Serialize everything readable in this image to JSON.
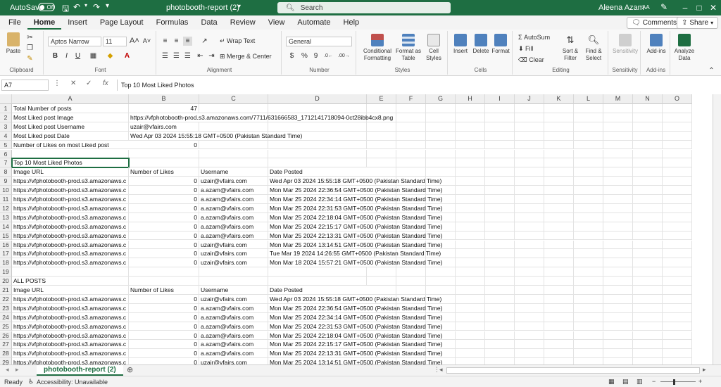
{
  "titlebar": {
    "autosave_label": "AutoSave",
    "autosave_state": "Off",
    "doc_title": "photobooth-report (2)",
    "search_placeholder": "Search",
    "user_name": "Aleena Azam",
    "user_initials": "AA"
  },
  "menu": {
    "tabs": [
      "File",
      "Home",
      "Insert",
      "Page Layout",
      "Formulas",
      "Data",
      "Review",
      "View",
      "Automate",
      "Help"
    ],
    "active": "Home",
    "comments_label": "Comments",
    "share_label": "Share"
  },
  "ribbon": {
    "clipboard": {
      "paste_label": "Paste",
      "group_label": "Clipboard"
    },
    "font": {
      "font_name": "Aptos Narrow",
      "font_size": "11",
      "group_label": "Font",
      "bold": "B",
      "italic": "I",
      "underline": "U"
    },
    "alignment": {
      "wrap_label": "Wrap Text",
      "merge_label": "Merge & Center",
      "group_label": "Alignment"
    },
    "number": {
      "format": "General",
      "group_label": "Number"
    },
    "styles": {
      "conditional_label": "Conditional Formatting",
      "format_table_label": "Format as Table",
      "cell_styles_label": "Cell Styles",
      "group_label": "Styles"
    },
    "cells": {
      "insert_label": "Insert",
      "delete_label": "Delete",
      "format_label": "Format",
      "group_label": "Cells"
    },
    "editing": {
      "autosum_label": "AutoSum",
      "fill_label": "Fill",
      "clear_label": "Clear",
      "sort_label": "Sort & Filter",
      "find_label": "Find & Select",
      "group_label": "Editing"
    },
    "sensitivity": {
      "label": "Sensitivity",
      "group_label": "Sensitivity"
    },
    "addins": {
      "label": "Add-ins",
      "group_label": "Add-ins"
    },
    "analyze": {
      "label": "Analyze Data"
    }
  },
  "formula_bar": {
    "name_box": "A7",
    "fx": "fx",
    "content": "Top 10 Most Liked Photos"
  },
  "columns": [
    "A",
    "B",
    "C",
    "D",
    "E",
    "F",
    "G",
    "H",
    "I",
    "J",
    "K",
    "L",
    "M",
    "N",
    "O"
  ],
  "rows": [
    {
      "n": "1",
      "A": "Total Number of posts",
      "B": "47",
      "C": "",
      "D": ""
    },
    {
      "n": "2",
      "A": "Most Liked post Image",
      "B": "https://vfphotobooth-prod.s3.amazonaws.com/7711/631666583_1712141718094-0ct28ibb4cx8.png",
      "C": "",
      "D": ""
    },
    {
      "n": "3",
      "A": "Most Liked post Username",
      "B": "uzair@vfairs.com",
      "C": "",
      "D": ""
    },
    {
      "n": "4",
      "A": "Most Liked post Date",
      "B": "Wed Apr 03 2024 15:55:18 GMT+0500 (Pakistan Standard Time)",
      "C": "",
      "D": ""
    },
    {
      "n": "5",
      "A": "Number of Likes on most Liked post",
      "B": "0",
      "C": "",
      "D": ""
    },
    {
      "n": "6",
      "A": "",
      "B": "",
      "C": "",
      "D": ""
    },
    {
      "n": "7",
      "A": "Top 10 Most Liked Photos",
      "B": "",
      "C": "",
      "D": ""
    },
    {
      "n": "8",
      "A": "Image URL",
      "B": "Number of Likes",
      "C": "Username",
      "D": "Date Posted"
    },
    {
      "n": "9",
      "A": "https://vfphotobooth-prod.s3.amazonaws.c",
      "B": "0",
      "C": "uzair@vfairs.com",
      "D": "Wed Apr 03 2024 15:55:18 GMT+0500 (Pakistan Standard Time)"
    },
    {
      "n": "10",
      "A": "https://vfphotobooth-prod.s3.amazonaws.c",
      "B": "0",
      "C": "a.azam@vfairs.com",
      "D": "Mon Mar 25 2024 22:36:54 GMT+0500 (Pakistan Standard Time)"
    },
    {
      "n": "11",
      "A": "https://vfphotobooth-prod.s3.amazonaws.c",
      "B": "0",
      "C": "a.azam@vfairs.com",
      "D": "Mon Mar 25 2024 22:34:14 GMT+0500 (Pakistan Standard Time)"
    },
    {
      "n": "12",
      "A": "https://vfphotobooth-prod.s3.amazonaws.c",
      "B": "0",
      "C": "a.azam@vfairs.com",
      "D": "Mon Mar 25 2024 22:31:53 GMT+0500 (Pakistan Standard Time)"
    },
    {
      "n": "13",
      "A": "https://vfphotobooth-prod.s3.amazonaws.c",
      "B": "0",
      "C": "a.azam@vfairs.com",
      "D": "Mon Mar 25 2024 22:18:04 GMT+0500 (Pakistan Standard Time)"
    },
    {
      "n": "14",
      "A": "https://vfphotobooth-prod.s3.amazonaws.c",
      "B": "0",
      "C": "a.azam@vfairs.com",
      "D": "Mon Mar 25 2024 22:15:17 GMT+0500 (Pakistan Standard Time)"
    },
    {
      "n": "15",
      "A": "https://vfphotobooth-prod.s3.amazonaws.c",
      "B": "0",
      "C": "a.azam@vfairs.com",
      "D": "Mon Mar 25 2024 22:13:31 GMT+0500 (Pakistan Standard Time)"
    },
    {
      "n": "16",
      "A": "https://vfphotobooth-prod.s3.amazonaws.c",
      "B": "0",
      "C": "uzair@vfairs.com",
      "D": "Mon Mar 25 2024 13:14:51 GMT+0500 (Pakistan Standard Time)"
    },
    {
      "n": "17",
      "A": "https://vfphotobooth-prod.s3.amazonaws.c",
      "B": "0",
      "C": "uzair@vfairs.com",
      "D": "Tue Mar 19 2024 14:26:55 GMT+0500 (Pakistan Standard Time)"
    },
    {
      "n": "18",
      "A": "https://vfphotobooth-prod.s3.amazonaws.c",
      "B": "0",
      "C": "uzair@vfairs.com",
      "D": "Mon Mar 18 2024 15:57:21 GMT+0500 (Pakistan Standard Time)"
    },
    {
      "n": "19",
      "A": "",
      "B": "",
      "C": "",
      "D": ""
    },
    {
      "n": "20",
      "A": "ALL POSTS",
      "B": "",
      "C": "",
      "D": ""
    },
    {
      "n": "21",
      "A": "Image URL",
      "B": "Number of Likes",
      "C": "Username",
      "D": "Date Posted"
    },
    {
      "n": "22",
      "A": "https://vfphotobooth-prod.s3.amazonaws.c",
      "B": "0",
      "C": "uzair@vfairs.com",
      "D": "Wed Apr 03 2024 15:55:18 GMT+0500 (Pakistan Standard Time)"
    },
    {
      "n": "23",
      "A": "https://vfphotobooth-prod.s3.amazonaws.c",
      "B": "0",
      "C": "a.azam@vfairs.com",
      "D": "Mon Mar 25 2024 22:36:54 GMT+0500 (Pakistan Standard Time)"
    },
    {
      "n": "24",
      "A": "https://vfphotobooth-prod.s3.amazonaws.c",
      "B": "0",
      "C": "a.azam@vfairs.com",
      "D": "Mon Mar 25 2024 22:34:14 GMT+0500 (Pakistan Standard Time)"
    },
    {
      "n": "25",
      "A": "https://vfphotobooth-prod.s3.amazonaws.c",
      "B": "0",
      "C": "a.azam@vfairs.com",
      "D": "Mon Mar 25 2024 22:31:53 GMT+0500 (Pakistan Standard Time)"
    },
    {
      "n": "26",
      "A": "https://vfphotobooth-prod.s3.amazonaws.c",
      "B": "0",
      "C": "a.azam@vfairs.com",
      "D": "Mon Mar 25 2024 22:18:04 GMT+0500 (Pakistan Standard Time)"
    },
    {
      "n": "27",
      "A": "https://vfphotobooth-prod.s3.amazonaws.c",
      "B": "0",
      "C": "a.azam@vfairs.com",
      "D": "Mon Mar 25 2024 22:15:17 GMT+0500 (Pakistan Standard Time)"
    },
    {
      "n": "28",
      "A": "https://vfphotobooth-prod.s3.amazonaws.c",
      "B": "0",
      "C": "a.azam@vfairs.com",
      "D": "Mon Mar 25 2024 22:13:31 GMT+0500 (Pakistan Standard Time)"
    },
    {
      "n": "29",
      "A": "https://vfphotobooth-prod.s3.amazonaws.c",
      "B": "0",
      "C": "uzair@vfairs.com",
      "D": "Mon Mar 25 2024 13:14:51 GMT+0500 (Pakistan Standard Time)"
    }
  ],
  "sheet": {
    "active_tab": "photobooth-report (2)"
  },
  "status": {
    "ready": "Ready",
    "accessibility": "Accessibility: Unavailable"
  },
  "colors": {
    "brand": "#1e6e42",
    "grid_header": "#efefef"
  }
}
